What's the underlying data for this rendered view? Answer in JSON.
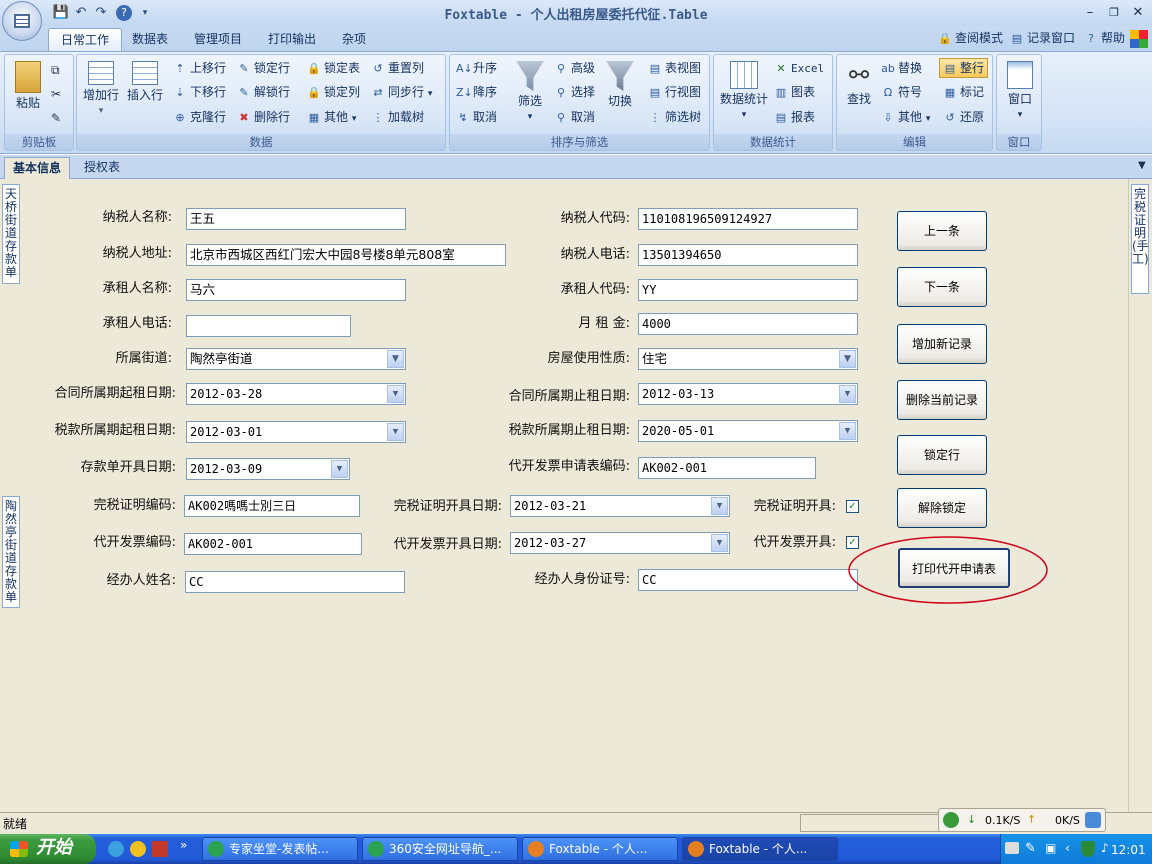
{
  "window": {
    "title": "Foxtable - 个人出租房屋委托代征.Table"
  },
  "ribbon_tabs": [
    "日常工作",
    "数据表",
    "管理项目",
    "打印输出",
    "杂项"
  ],
  "ribbon_right": {
    "view_mode": "查阅模式",
    "record_window": "记录窗口",
    "help": "帮助"
  },
  "groups": {
    "clipboard": {
      "label": "剪贴板",
      "paste": "粘贴"
    },
    "data": {
      "label": "数据",
      "add_row": "增加行",
      "insert_row": "插入行",
      "move_up": "上移行",
      "move_down": "下移行",
      "clone_row": "克隆行",
      "lock_row": "锁定行",
      "unlock_row": "解锁行",
      "delete_row": "删除行",
      "lock_table": "锁定表",
      "lock_col": "锁定列",
      "other": "其他",
      "reset_col": "重置列",
      "sync_row": "同步行",
      "load_tree": "加载树"
    },
    "sort_filter": {
      "label": "排序与筛选",
      "asc": "升序",
      "desc": "降序",
      "cancel": "取消",
      "filter": "筛选",
      "advanced": "高级",
      "select": "选择",
      "cancel2": "取消",
      "switch": "切换",
      "table_view": "表视图",
      "row_view": "行视图",
      "filter_tree": "筛选树"
    },
    "stats": {
      "label": "数据统计",
      "stats": "数据统计",
      "excel": "Excel",
      "chart": "图表",
      "report": "报表"
    },
    "edit": {
      "label": "编辑",
      "find": "查找",
      "replace": "替换",
      "symbol": "符号",
      "other": "其他",
      "whole_row": "整行",
      "mark": "标记",
      "restore": "还原"
    },
    "window": {
      "label": "窗口",
      "window": "窗口"
    }
  },
  "doc_tabs": [
    "基本信息",
    "授权表"
  ],
  "side_left": [
    "天桥街道存款单",
    "陶然亭街道存款单"
  ],
  "side_right": [
    "完税证明(手工)"
  ],
  "form": {
    "taxpayer_name": {
      "label": "纳税人名称:",
      "value": "王五"
    },
    "taxpayer_code": {
      "label": "纳税人代码:",
      "value": "110108196509124927"
    },
    "taxpayer_address": {
      "label": "纳税人地址:",
      "value": "北京市西城区西红门宏大中园8号楼8单元808室"
    },
    "taxpayer_phone": {
      "label": "纳税人电话:",
      "value": "13501394650"
    },
    "lessee_name": {
      "label": "承租人名称:",
      "value": "马六"
    },
    "lessee_code": {
      "label": "承租人代码:",
      "value": "YY"
    },
    "lessee_phone": {
      "label": "承租人电话:",
      "value": ""
    },
    "monthly_rent": {
      "label": "月 租 金:",
      "value": "4000"
    },
    "street": {
      "label": "所属街道:",
      "value": "陶然亭街道"
    },
    "usage": {
      "label": "房屋使用性质:",
      "value": "住宅"
    },
    "contract_start": {
      "label": "合同所属期起租日期:",
      "value": "2012-03-28"
    },
    "contract_end": {
      "label": "合同所属期止租日期:",
      "value": "2012-03-13"
    },
    "tax_start": {
      "label": "税款所属期起租日期:",
      "value": "2012-03-01"
    },
    "tax_end": {
      "label": "税款所属期止租日期:",
      "value": "2020-05-01"
    },
    "deposit_date": {
      "label": "存款单开具日期:",
      "value": "2012-03-09"
    },
    "invoice_app_code": {
      "label": "代开发票申请表编码:",
      "value": "AK002-001"
    },
    "tax_cert_code": {
      "label": "完税证明编码:",
      "value": "AK002嗎嗎士別三日"
    },
    "tax_cert_date": {
      "label": "完税证明开具日期:",
      "value": "2012-03-21"
    },
    "tax_cert_issued": {
      "label": "完税证明开具:",
      "checked": true
    },
    "invoice_code": {
      "label": "代开发票编码:",
      "value": "AK002-001"
    },
    "invoice_date": {
      "label": "代开发票开具日期:",
      "value": "2012-03-27"
    },
    "invoice_issued": {
      "label": "代开发票开具:",
      "checked": true
    },
    "handler_name": {
      "label": "经办人姓名:",
      "value": "CC"
    },
    "handler_id": {
      "label": "经办人身份证号:",
      "value": "CC"
    }
  },
  "buttons": {
    "prev": "上一条",
    "next": "下一条",
    "add": "增加新记录",
    "delete": "删除当前记录",
    "lock": "锁定行",
    "unlock": "解除锁定",
    "print": "打印代开申请表"
  },
  "status": {
    "text": "就绪",
    "down_speed": "0.1K/S",
    "up_speed": "0K/S"
  },
  "taskbar": {
    "start": "开始",
    "tasks": [
      "专家坐堂-发表帖...",
      "360安全网址导航_...",
      "Foxtable - 个人...",
      "Foxtable - 个人..."
    ],
    "clock": "12:01"
  },
  "colors": {
    "annotation": "#d0021b",
    "ribbon_accent": "#f7c95a"
  }
}
